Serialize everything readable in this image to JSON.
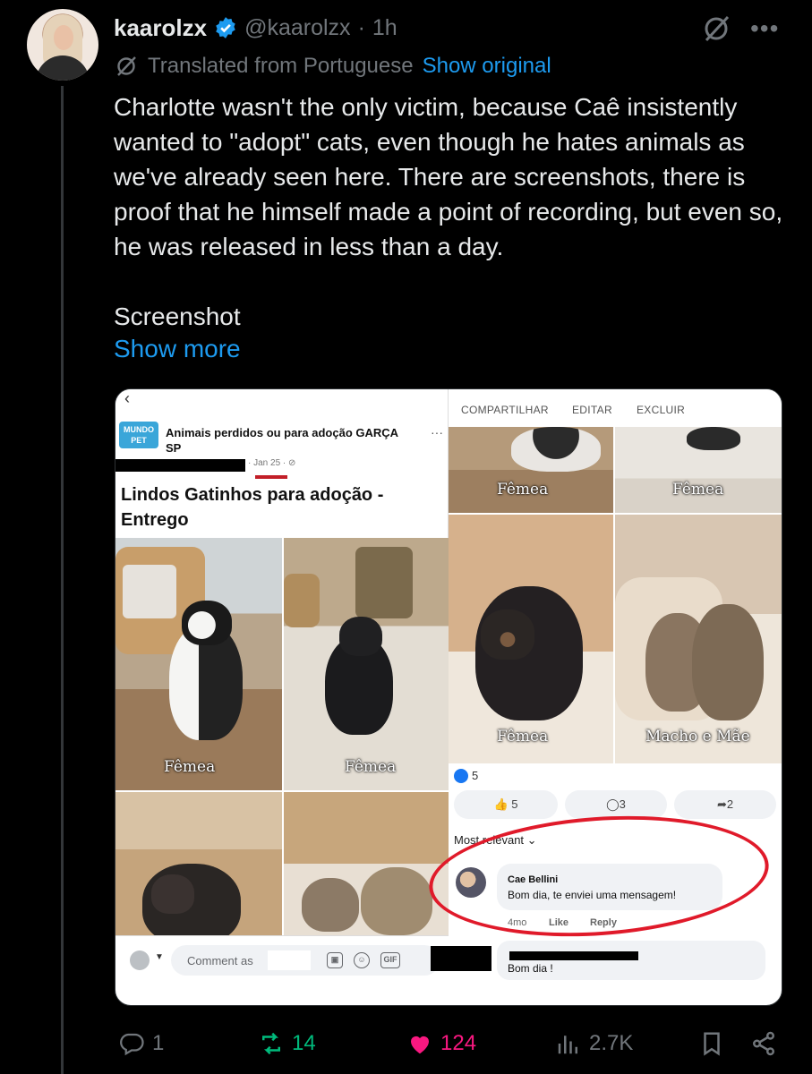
{
  "author": {
    "name": "kaarolzx",
    "handle": "@kaarolzx",
    "separator": "·",
    "time": "1h",
    "verified": true
  },
  "translation": {
    "label": "Translated from Portuguese",
    "show_original": "Show original"
  },
  "tweet": {
    "text": "Charlotte wasn't the only victim, because Caê insistently wanted to \"adopt\" cats, even though he hates animals as we've already seen here. There are screenshots, there is proof that he himself made a point of recording, but even so, he was released in less than a day.\n\nScreenshot",
    "show_more": "Show more"
  },
  "media": {
    "back_glyph": "‹",
    "fb_actions": {
      "share": "COMPARTILHAR",
      "edit": "EDITAR",
      "delete": "EXCLUIR"
    },
    "group": {
      "logo_text": "MUNDO PET",
      "name": "Animais perdidos ou para adoção GARÇA SP",
      "more": "···",
      "date": "· Jan 25 · ⊘"
    },
    "post_title": "Lindos Gatinhos para adoção - Entrego",
    "captions": {
      "top_left": "Fêmea",
      "top_right": "Fêmea",
      "mid_left": "Fêmea",
      "mid_right": "Macho e Mãe",
      "left_1": "Fêmea",
      "left_2": "Fêmea"
    },
    "reaction_count": "5",
    "buttons": {
      "like": "👍 5",
      "comment": "◯3",
      "share": "➦2"
    },
    "most_relevant": "Most relevant ⌄",
    "comment": {
      "name": "Cae Bellini",
      "text": "Bom dia, te enviei uma mensagem!",
      "age": "4mo",
      "like": "Like",
      "reply": "Reply"
    },
    "comment2_text": "Bom dia !",
    "comment_bar": {
      "placeholder": "Comment as",
      "gif": "GIF"
    }
  },
  "actions": {
    "replies": "1",
    "reposts": "14",
    "likes": "124",
    "views": "2.7K"
  },
  "colors": {
    "background": "#000000",
    "text": "#e7e9ea",
    "muted": "#71767b",
    "link": "#1d9bf0",
    "repost": "#00ba7c",
    "like": "#f91880",
    "highlight_circle": "#e01a2a"
  }
}
